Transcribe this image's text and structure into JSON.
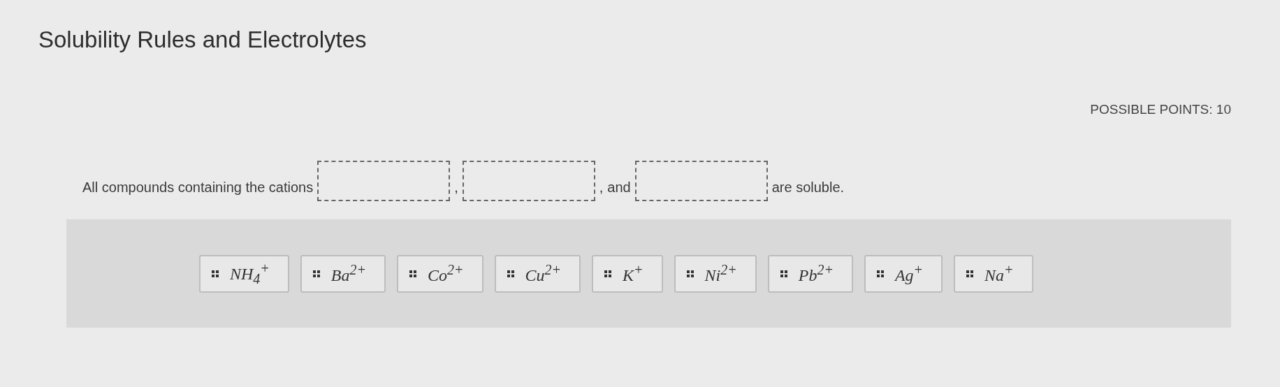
{
  "title": "Solubility Rules and Electrolytes",
  "possible_points": "POSSIBLE POINTS: 10",
  "sentence": [
    {
      "kind": "text",
      "text": "All compounds containing the cations"
    },
    {
      "kind": "blank"
    },
    {
      "kind": "text",
      "text": ","
    },
    {
      "kind": "blank"
    },
    {
      "kind": "text",
      "text": ","
    },
    {
      "kind": "text",
      "text": "and"
    },
    {
      "kind": "blank"
    },
    {
      "kind": "text",
      "text": "are soluble."
    }
  ],
  "choices": [
    "NH$_{4}$$^{+}$",
    "Ba$^{2+}$",
    "Co$^{2+}$",
    "Cu$^{2+}$",
    "K$^{+}$",
    "Ni$^{2+}$",
    "Pb$^{2+}$",
    "Ag$^{+}$",
    "Na$^{+}$"
  ]
}
